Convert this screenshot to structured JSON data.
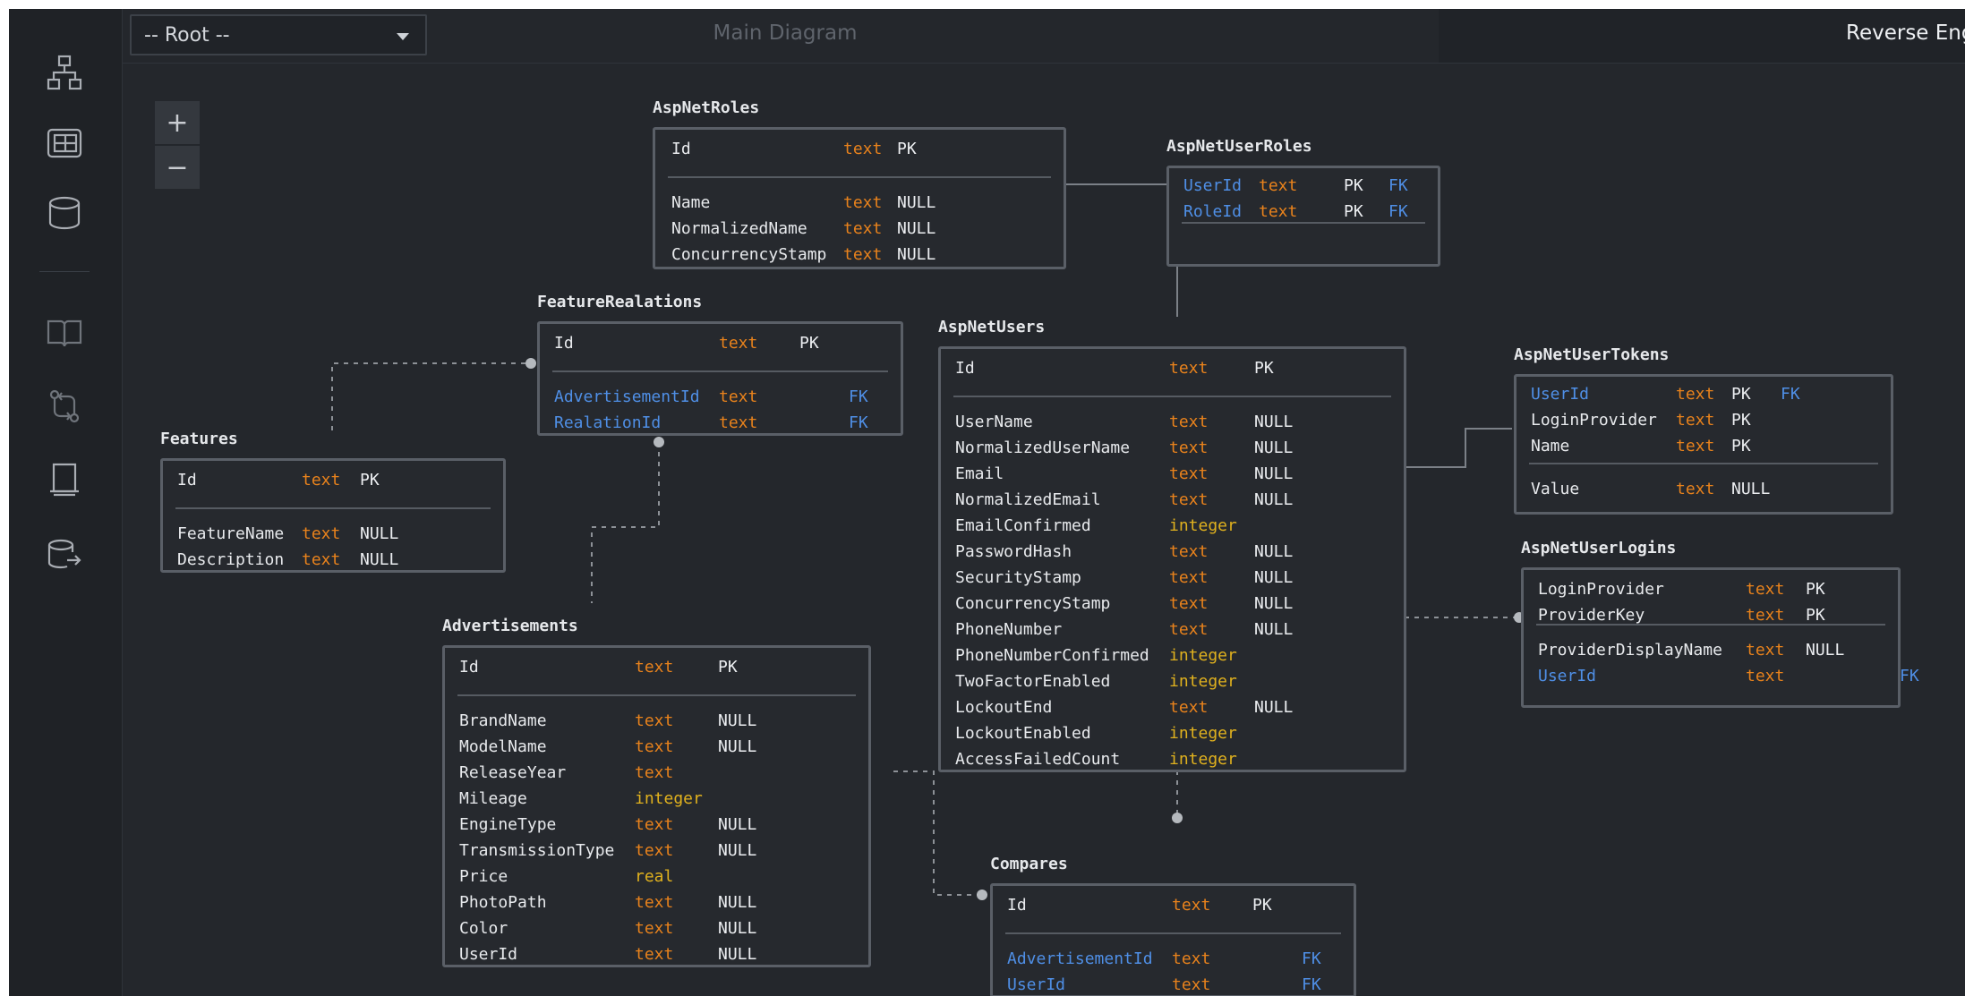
{
  "root_select": "-- Root --",
  "diagram_title": "Main Diagram",
  "reverse_label": "Reverse Engineer",
  "zoom": {
    "in": "+",
    "out": "−"
  },
  "sidebar_icons": [
    "hierarchy-icon",
    "table-icon",
    "database-icon",
    "book-icon",
    "compare-icon",
    "document-icon",
    "database-export-icon"
  ],
  "colors": {
    "background": "#24272c",
    "column_name": "#e8eaed",
    "foreign_key": "#4f8fe6",
    "type_text": "#e8821c",
    "type_numeric": "#e0b11e"
  },
  "entities": {
    "aspnetroles": {
      "name": "AspNetRoles",
      "pk": [
        {
          "name": "Id",
          "type": "text",
          "key": "PK"
        }
      ],
      "cols": [
        {
          "name": "Name",
          "type": "text",
          "null": "NULL"
        },
        {
          "name": "NormalizedName",
          "type": "text",
          "null": "NULL"
        },
        {
          "name": "ConcurrencyStamp",
          "type": "text",
          "null": "NULL"
        }
      ]
    },
    "aspnetuserroles": {
      "name": "AspNetUserRoles",
      "pk": [
        {
          "name": "UserId",
          "type": "text",
          "key": "PK",
          "fk": "FK"
        },
        {
          "name": "RoleId",
          "type": "text",
          "key": "PK",
          "fk": "FK"
        }
      ],
      "cols": []
    },
    "featurerealations": {
      "name": "FeatureRealations",
      "pk": [
        {
          "name": "Id",
          "type": "text",
          "key": "PK"
        }
      ],
      "cols": [
        {
          "name": "AdvertisementId",
          "type": "text",
          "fk": "FK"
        },
        {
          "name": "RealationId",
          "type": "text",
          "fk": "FK"
        }
      ]
    },
    "features": {
      "name": "Features",
      "pk": [
        {
          "name": "Id",
          "type": "text",
          "key": "PK"
        }
      ],
      "cols": [
        {
          "name": "FeatureName",
          "type": "text",
          "null": "NULL"
        },
        {
          "name": "Description",
          "type": "text",
          "null": "NULL"
        }
      ]
    },
    "aspnetusers": {
      "name": "AspNetUsers",
      "pk": [
        {
          "name": "Id",
          "type": "text",
          "key": "PK"
        }
      ],
      "cols": [
        {
          "name": "UserName",
          "type": "text",
          "null": "NULL"
        },
        {
          "name": "NormalizedUserName",
          "type": "text",
          "null": "NULL"
        },
        {
          "name": "Email",
          "type": "text",
          "null": "NULL"
        },
        {
          "name": "NormalizedEmail",
          "type": "text",
          "null": "NULL"
        },
        {
          "name": "EmailConfirmed",
          "type": "integer"
        },
        {
          "name": "PasswordHash",
          "type": "text",
          "null": "NULL"
        },
        {
          "name": "SecurityStamp",
          "type": "text",
          "null": "NULL"
        },
        {
          "name": "ConcurrencyStamp",
          "type": "text",
          "null": "NULL"
        },
        {
          "name": "PhoneNumber",
          "type": "text",
          "null": "NULL"
        },
        {
          "name": "PhoneNumberConfirmed",
          "type": "integer"
        },
        {
          "name": "TwoFactorEnabled",
          "type": "integer"
        },
        {
          "name": "LockoutEnd",
          "type": "text",
          "null": "NULL"
        },
        {
          "name": "LockoutEnabled",
          "type": "integer"
        },
        {
          "name": "AccessFailedCount",
          "type": "integer"
        }
      ]
    },
    "aspnetusertokens": {
      "name": "AspNetUserTokens",
      "pk": [
        {
          "name": "UserId",
          "type": "text",
          "key": "PK",
          "fk": "FK"
        },
        {
          "name": "LoginProvider",
          "type": "text",
          "key": "PK"
        },
        {
          "name": "Name",
          "type": "text",
          "key": "PK"
        }
      ],
      "cols": [
        {
          "name": "Value",
          "type": "text",
          "null": "NULL"
        }
      ]
    },
    "aspnetuserlogins": {
      "name": "AspNetUserLogins",
      "pk": [
        {
          "name": "LoginProvider",
          "type": "text",
          "key": "PK"
        },
        {
          "name": "ProviderKey",
          "type": "text",
          "key": "PK"
        }
      ],
      "cols": [
        {
          "name": "ProviderDisplayName",
          "type": "text",
          "null": "NULL"
        },
        {
          "name": "UserId",
          "type": "text",
          "fk": "FK"
        }
      ]
    },
    "advertisements": {
      "name": "Advertisements",
      "pk": [
        {
          "name": "Id",
          "type": "text",
          "key": "PK"
        }
      ],
      "cols": [
        {
          "name": "BrandName",
          "type": "text",
          "null": "NULL"
        },
        {
          "name": "ModelName",
          "type": "text",
          "null": "NULL"
        },
        {
          "name": "ReleaseYear",
          "type": "text"
        },
        {
          "name": "Mileage",
          "type": "integer"
        },
        {
          "name": "EngineType",
          "type": "text",
          "null": "NULL"
        },
        {
          "name": "TransmissionType",
          "type": "text",
          "null": "NULL"
        },
        {
          "name": "Price",
          "type": "real"
        },
        {
          "name": "PhotoPath",
          "type": "text",
          "null": "NULL"
        },
        {
          "name": "Color",
          "type": "text",
          "null": "NULL"
        },
        {
          "name": "UserId",
          "type": "text",
          "null": "NULL"
        }
      ]
    },
    "compares": {
      "name": "Compares",
      "pk": [
        {
          "name": "Id",
          "type": "text",
          "key": "PK"
        }
      ],
      "cols": [
        {
          "name": "AdvertisementId",
          "type": "text",
          "fk": "FK"
        },
        {
          "name": "UserId",
          "type": "text",
          "fk": "FK"
        }
      ]
    }
  }
}
